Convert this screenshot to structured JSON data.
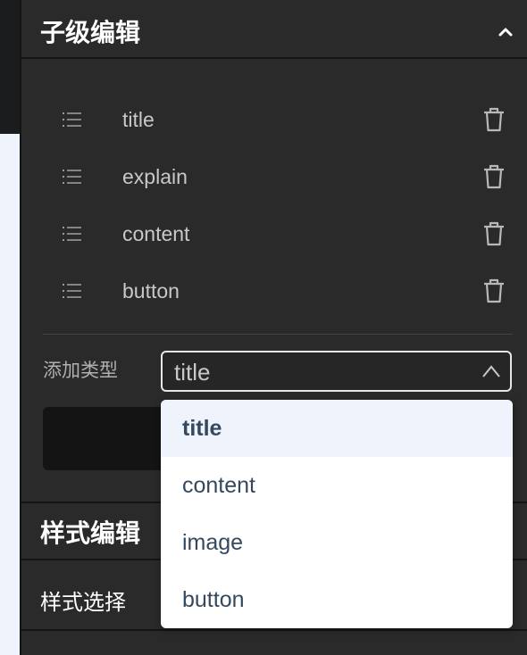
{
  "child_editor": {
    "title": "子级编辑",
    "items": [
      {
        "label": "title"
      },
      {
        "label": "explain"
      },
      {
        "label": "content"
      },
      {
        "label": "button"
      }
    ],
    "add_type_label": "添加类型",
    "select_value": "title"
  },
  "dropdown": {
    "options": [
      {
        "label": "title",
        "selected": true
      },
      {
        "label": "content",
        "selected": false
      },
      {
        "label": "image",
        "selected": false
      },
      {
        "label": "button",
        "selected": false
      }
    ]
  },
  "style_editor": {
    "title": "样式编辑",
    "style_select_label": "样式选择"
  },
  "icons": {
    "collapse": "chevron-up-icon",
    "drag": "list-icon",
    "delete": "trash-icon",
    "select_arrow": "chevron-up-icon"
  },
  "colors": {
    "panel_bg": "#2a2a2a",
    "dropdown_selected_bg": "#eef3fc",
    "dropdown_text": "#34495e"
  }
}
